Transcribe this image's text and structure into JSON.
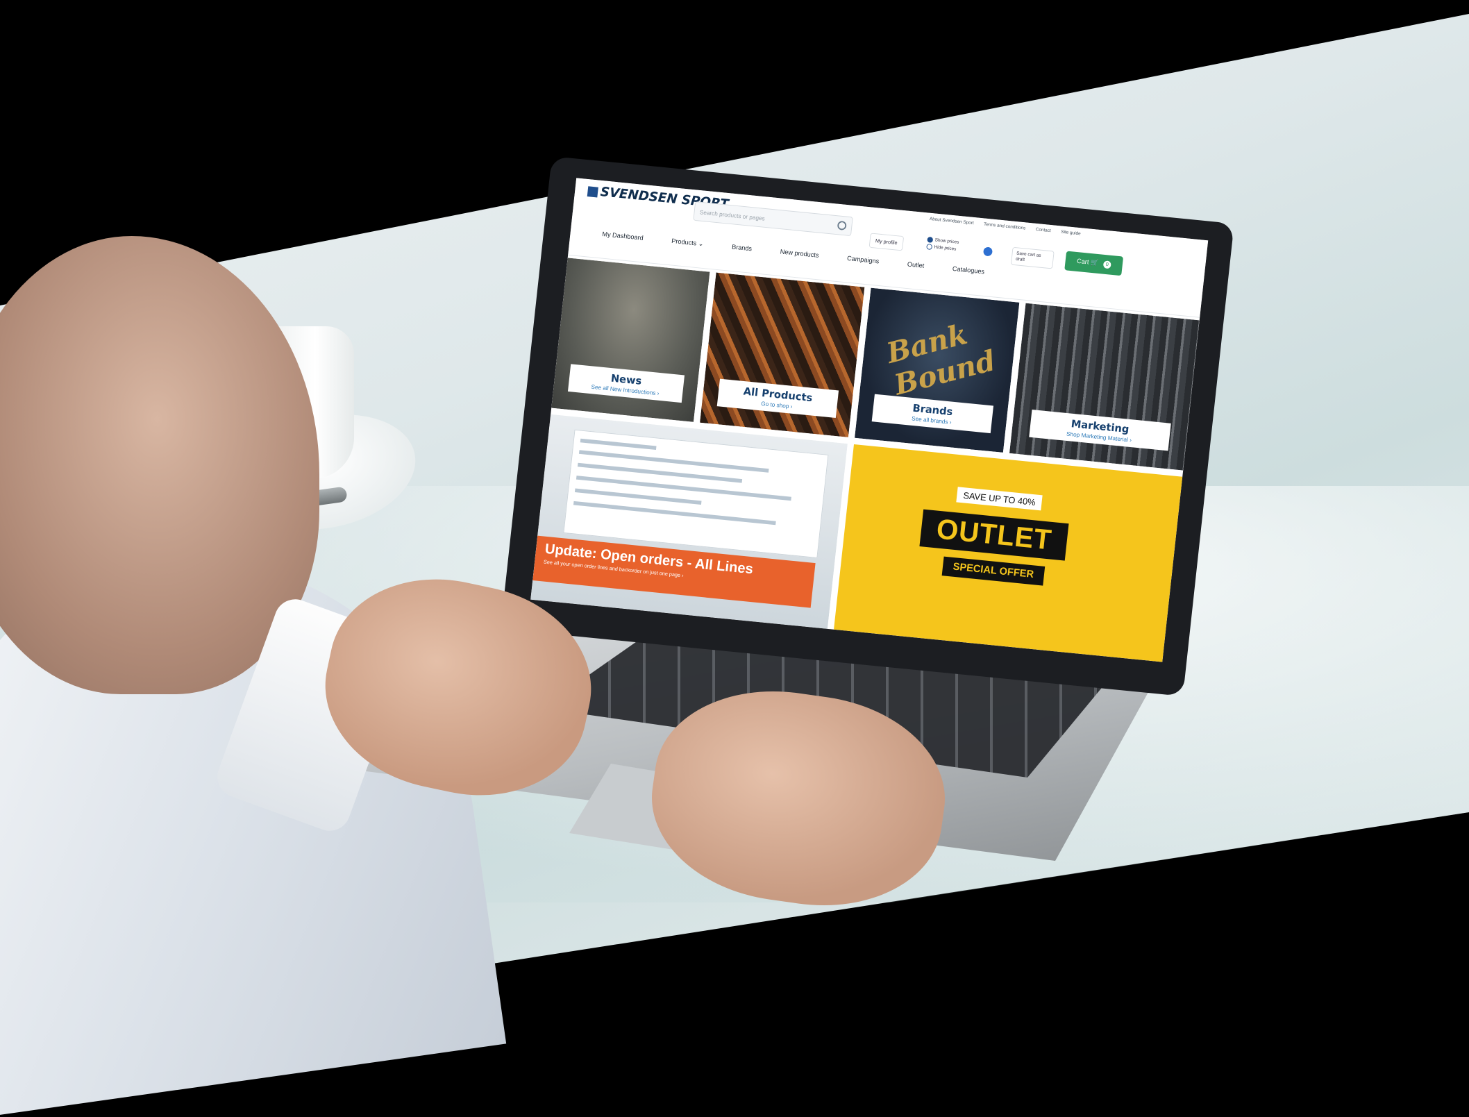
{
  "site": {
    "logo_text": "SVENDSEN SPORT",
    "search_placeholder": "Search products or pages",
    "top_links": [
      "About Svendsen Sport",
      "Terms and conditions",
      "Contact",
      "Site guide"
    ],
    "my_profile": "My profile",
    "price_options": [
      "Show prices",
      "Hide prices"
    ],
    "save_cart": "Save cart as draft",
    "cart_label": "Cart",
    "cart_count": "0",
    "nav": [
      "My Dashboard",
      "Products ⌄",
      "Brands",
      "New products",
      "Campaigns",
      "Outlet",
      "Catalogues"
    ],
    "colors": {
      "brand_blue": "#16406e",
      "cart_green": "#2f9a5e",
      "update_orange": "#e8622c",
      "outlet_yellow": "#f5c51c"
    }
  },
  "tiles": {
    "news": {
      "title": "News",
      "link": "See all New Introductions ›"
    },
    "all_products": {
      "title": "All Products",
      "link": "Go to shop ›"
    },
    "brands": {
      "title": "Brands",
      "link": "See all brands ›",
      "artwork_text": "Bank Bound"
    },
    "marketing": {
      "title": "Marketing",
      "link": "Shop Marketing Material ›"
    },
    "update": {
      "title": "Update: Open orders - All Lines",
      "text": "See all your open order lines and backorder on just one page ›"
    },
    "outlet": {
      "save": "SAVE UP TO 40%",
      "main": "OUTLET",
      "offer": "SPECIAL OFFER"
    }
  }
}
